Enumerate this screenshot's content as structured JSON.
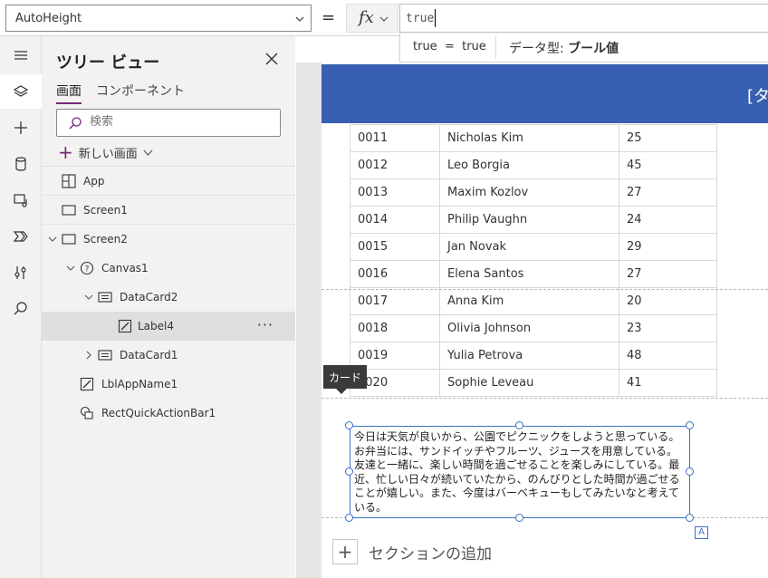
{
  "formula_bar": {
    "property": "AutoHeight",
    "equals": "=",
    "fx": "fx",
    "formula": "true"
  },
  "intellisense": {
    "expression": "true  =  true",
    "type_label": "データ型: ",
    "type_value": "ブール値"
  },
  "left_rail": {
    "icons": [
      "menu-icon",
      "layers-icon",
      "insert-icon",
      "data-icon",
      "media-icon",
      "power-automate-icon",
      "tools-icon",
      "search-icon"
    ]
  },
  "tree": {
    "title": "ツリー ビュー",
    "tabs": [
      "画面",
      "コンポーネント"
    ],
    "search_placeholder": "検索",
    "new_screen": "新しい画面",
    "nodes": [
      {
        "label": "App",
        "icon": "app-icon"
      },
      {
        "label": "Screen1",
        "icon": "screen-icon"
      },
      {
        "label": "Screen2",
        "icon": "screen-icon"
      },
      {
        "label": "Canvas1",
        "icon": "canvas-icon"
      },
      {
        "label": "DataCard2",
        "icon": "datacard-icon"
      },
      {
        "label": "Label4",
        "icon": "label-icon"
      },
      {
        "label": "DataCard1",
        "icon": "datacard-icon"
      },
      {
        "label": "LblAppName1",
        "icon": "label-icon"
      },
      {
        "label": "RectQuickActionBar1",
        "icon": "shapes-icon"
      }
    ]
  },
  "canvas": {
    "header_text": "[タ",
    "table_rows": [
      {
        "id": "0011",
        "name": "Nicholas Kim",
        "age": "25"
      },
      {
        "id": "0012",
        "name": "Leo Borgia",
        "age": "45"
      },
      {
        "id": "0013",
        "name": "Maxim Kozlov",
        "age": "27"
      },
      {
        "id": "0014",
        "name": "Philip Vaughn",
        "age": "24"
      },
      {
        "id": "0015",
        "name": "Jan Novak",
        "age": "29"
      },
      {
        "id": "0016",
        "name": "Elena Santos",
        "age": "27"
      },
      {
        "id": "0017",
        "name": "Anna Kim",
        "age": "20"
      },
      {
        "id": "0018",
        "name": "Olivia Johnson",
        "age": "23"
      },
      {
        "id": "0019",
        "name": "Yulia Petrova",
        "age": "48"
      },
      {
        "id": "0020",
        "name": "Sophie Leveau",
        "age": "41"
      }
    ],
    "card_tooltip": "カード",
    "label_text": "今日は天気が良いから、公園でピクニックをしようと思っている。お弁当には、サンドイッチやフルーツ、ジュースを用意している。友達と一緒に、楽しい時間を過ごせることを楽しみにしている。最近、忙しい日々が続いていたから、のんびりとした時間が過ごせることが嬉しい。また、今度はバーベキューもしてみたいなと考えている。",
    "label_badge": "A",
    "add_section": "セクションの追加"
  },
  "colors": {
    "header_blue": "#3860b2",
    "selection_blue": "#3b70c2",
    "accent_purple": "#742774"
  }
}
